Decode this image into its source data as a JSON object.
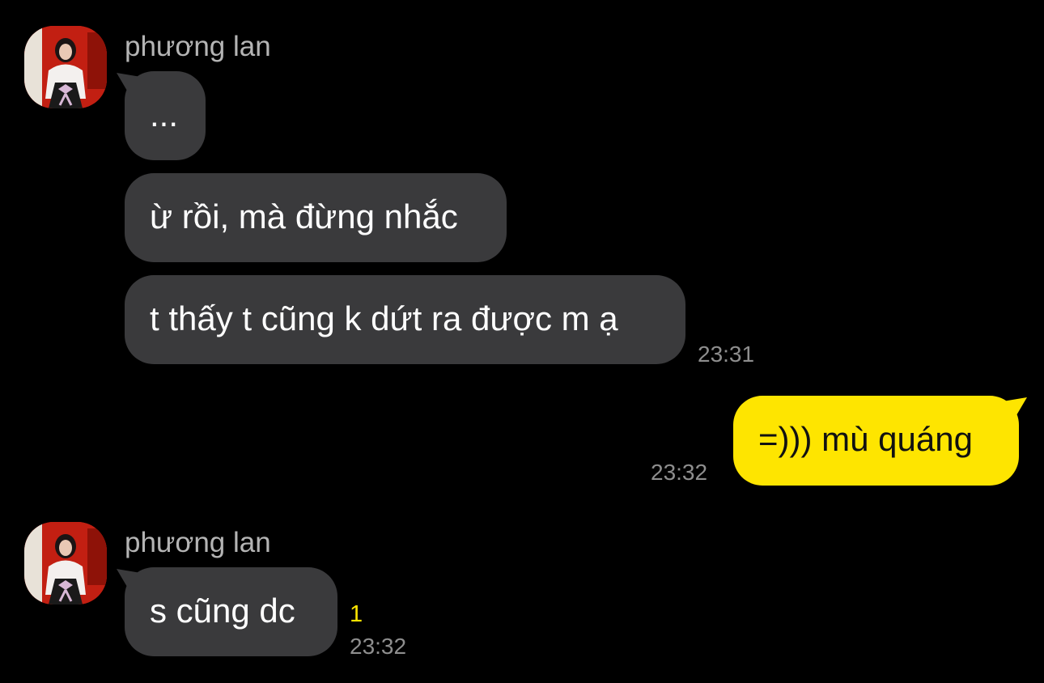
{
  "conversation": {
    "groups": [
      {
        "sender": "phương lan",
        "messages": [
          "...",
          "ừ rồi, mà đừng nhắc",
          "t thấy t cũng k dứt ra được m ạ"
        ],
        "time": "23:31"
      },
      {
        "sender": "me",
        "messages": [
          "=))) mù quáng"
        ],
        "time": "23:32"
      },
      {
        "sender": "phương lan",
        "messages": [
          "s cũng dc"
        ],
        "unread_count": "1",
        "time": "23:32"
      }
    ]
  },
  "theme": {
    "background": "#000000",
    "incoming_bubble": "#3a3a3c",
    "outgoing_bubble": "#fee500",
    "unread_color": "#fee500",
    "timestamp_color": "#8e8e8e",
    "name_color": "#b4b4b4",
    "avatar_bg": "#c21f12"
  }
}
